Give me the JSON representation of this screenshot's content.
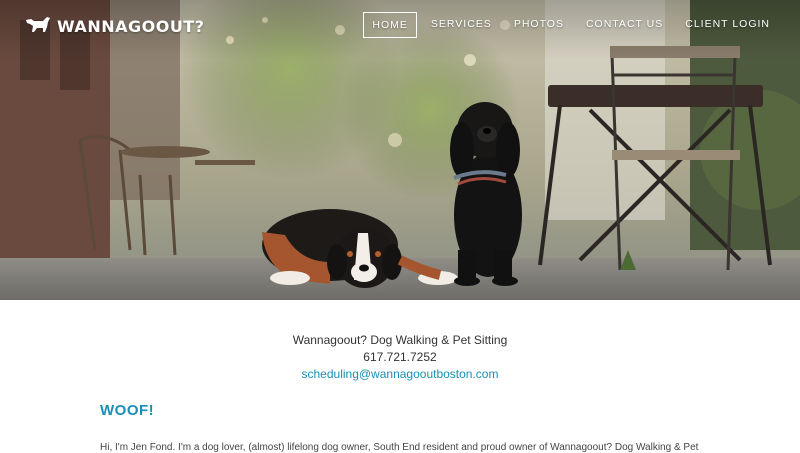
{
  "brand": {
    "name": "WANNAGOOUT?",
    "logo_icon": "dog-icon"
  },
  "nav": {
    "items": [
      {
        "label": "HOME",
        "active": true
      },
      {
        "label": "SERVICES",
        "active": false
      },
      {
        "label": "PHOTOS",
        "active": false
      },
      {
        "label": "CONTACT US",
        "active": false
      },
      {
        "label": "CLIENT LOGIN",
        "active": false
      }
    ]
  },
  "contact": {
    "title": "Wannagoout? Dog Walking & Pet Sitting",
    "phone": "617.721.7252",
    "email": "scheduling@wannagooutboston.com"
  },
  "about": {
    "heading": "WOOF!",
    "intro": "Hi, I'm Jen Fond. I'm a dog lover, (almost) lifelong dog owner, South End resident and proud owner of Wannagoout? Dog Walking & Pet"
  },
  "colors": {
    "accent": "#1a8fb5",
    "text": "#333333",
    "nav_text": "#ffffff"
  }
}
